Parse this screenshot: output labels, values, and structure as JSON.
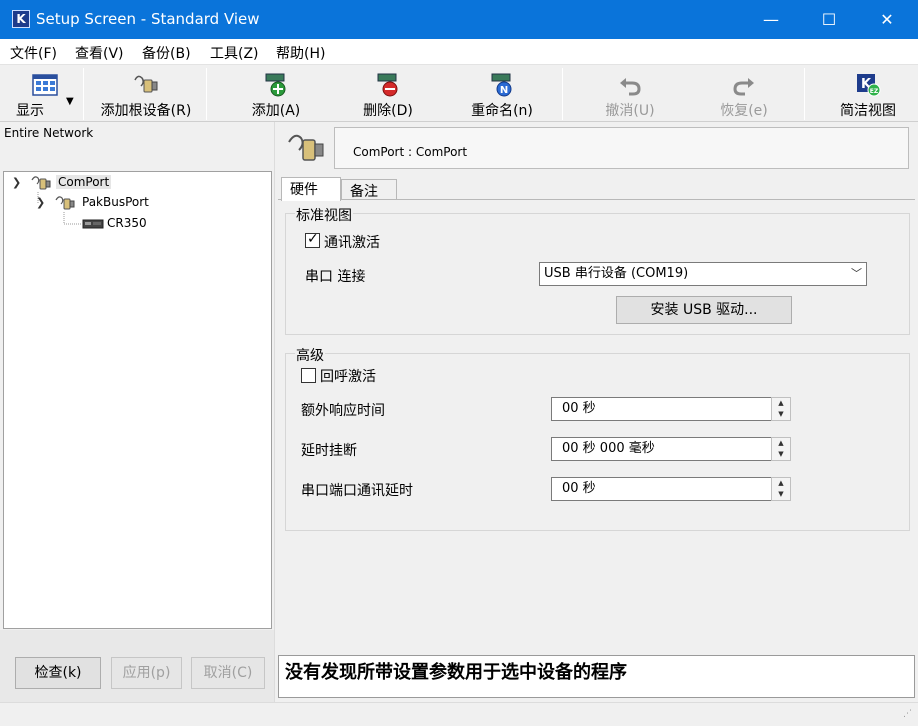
{
  "window": {
    "title": "Setup Screen - Standard View",
    "minimize": "—",
    "maximize": "☐",
    "close": "✕"
  },
  "menu": [
    "文件(F)",
    "查看(V)",
    "备份(B)",
    "工具(Z)",
    "帮助(H)"
  ],
  "toolbar": {
    "display": "显示",
    "add_root": "添加根设备(R)",
    "add": "添加(A)",
    "delete": "删除(D)",
    "rename": "重命名(n)",
    "undo": "撤消(U)",
    "redo": "恢复(e)",
    "ez_view": "简洁视图"
  },
  "left": {
    "header": "Entire Network",
    "tree": [
      {
        "label": "ComPort",
        "level": 0
      },
      {
        "label": "PakBusPort",
        "level": 1
      },
      {
        "label": "CR350",
        "level": 2
      }
    ],
    "buttons": {
      "check": "检查(k)",
      "apply": "应用(p)",
      "cancel": "取消(C)"
    }
  },
  "device": {
    "title": "ComPort : ComPort"
  },
  "tabs": [
    "硬件",
    "备注"
  ],
  "standard": {
    "group_title": "标准视图",
    "comm_enabled_label": "通讯激活",
    "comm_enabled": true,
    "com_port_label": "串口 连接",
    "com_port_value": "USB 串行设备 (COM19)",
    "install_usb_label": "安装 USB 驱动..."
  },
  "advanced": {
    "group_title": "高级",
    "callback_label": "回呼激活",
    "callback_enabled": false,
    "extra_response_label": "额外响应时间",
    "extra_response_value": "00 秒",
    "delay_hangup_label": "延时挂断",
    "delay_hangup_value": "00 秒 000 毫秒",
    "comm_delay_label": "串口端口通讯延时",
    "comm_delay_value": "00 秒"
  },
  "status_message": "没有发现所带设置参数用于选中设备的程序",
  "colors": {
    "titlebar": "#0a74da",
    "panel": "#f0f0f0"
  }
}
